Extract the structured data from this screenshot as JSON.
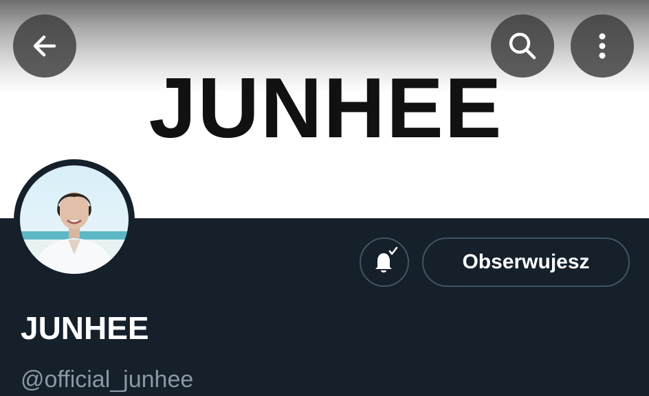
{
  "header": {
    "banner_text": "JUNHEE",
    "back_button": {
      "icon": "arrow-left-icon"
    },
    "search_button": {
      "icon": "search-icon"
    },
    "more_button": {
      "icon": "more-vertical-icon"
    }
  },
  "profile": {
    "display_name": "JUNHEE",
    "handle": "@official_junhee",
    "notifications_button": {
      "icon": "bell-check-icon"
    },
    "follow_button_label": "Obserwujesz"
  },
  "colors": {
    "background": "#15202b",
    "button_border": "#425466",
    "handle_text": "#8b98a5",
    "banner": "#ffffff"
  }
}
